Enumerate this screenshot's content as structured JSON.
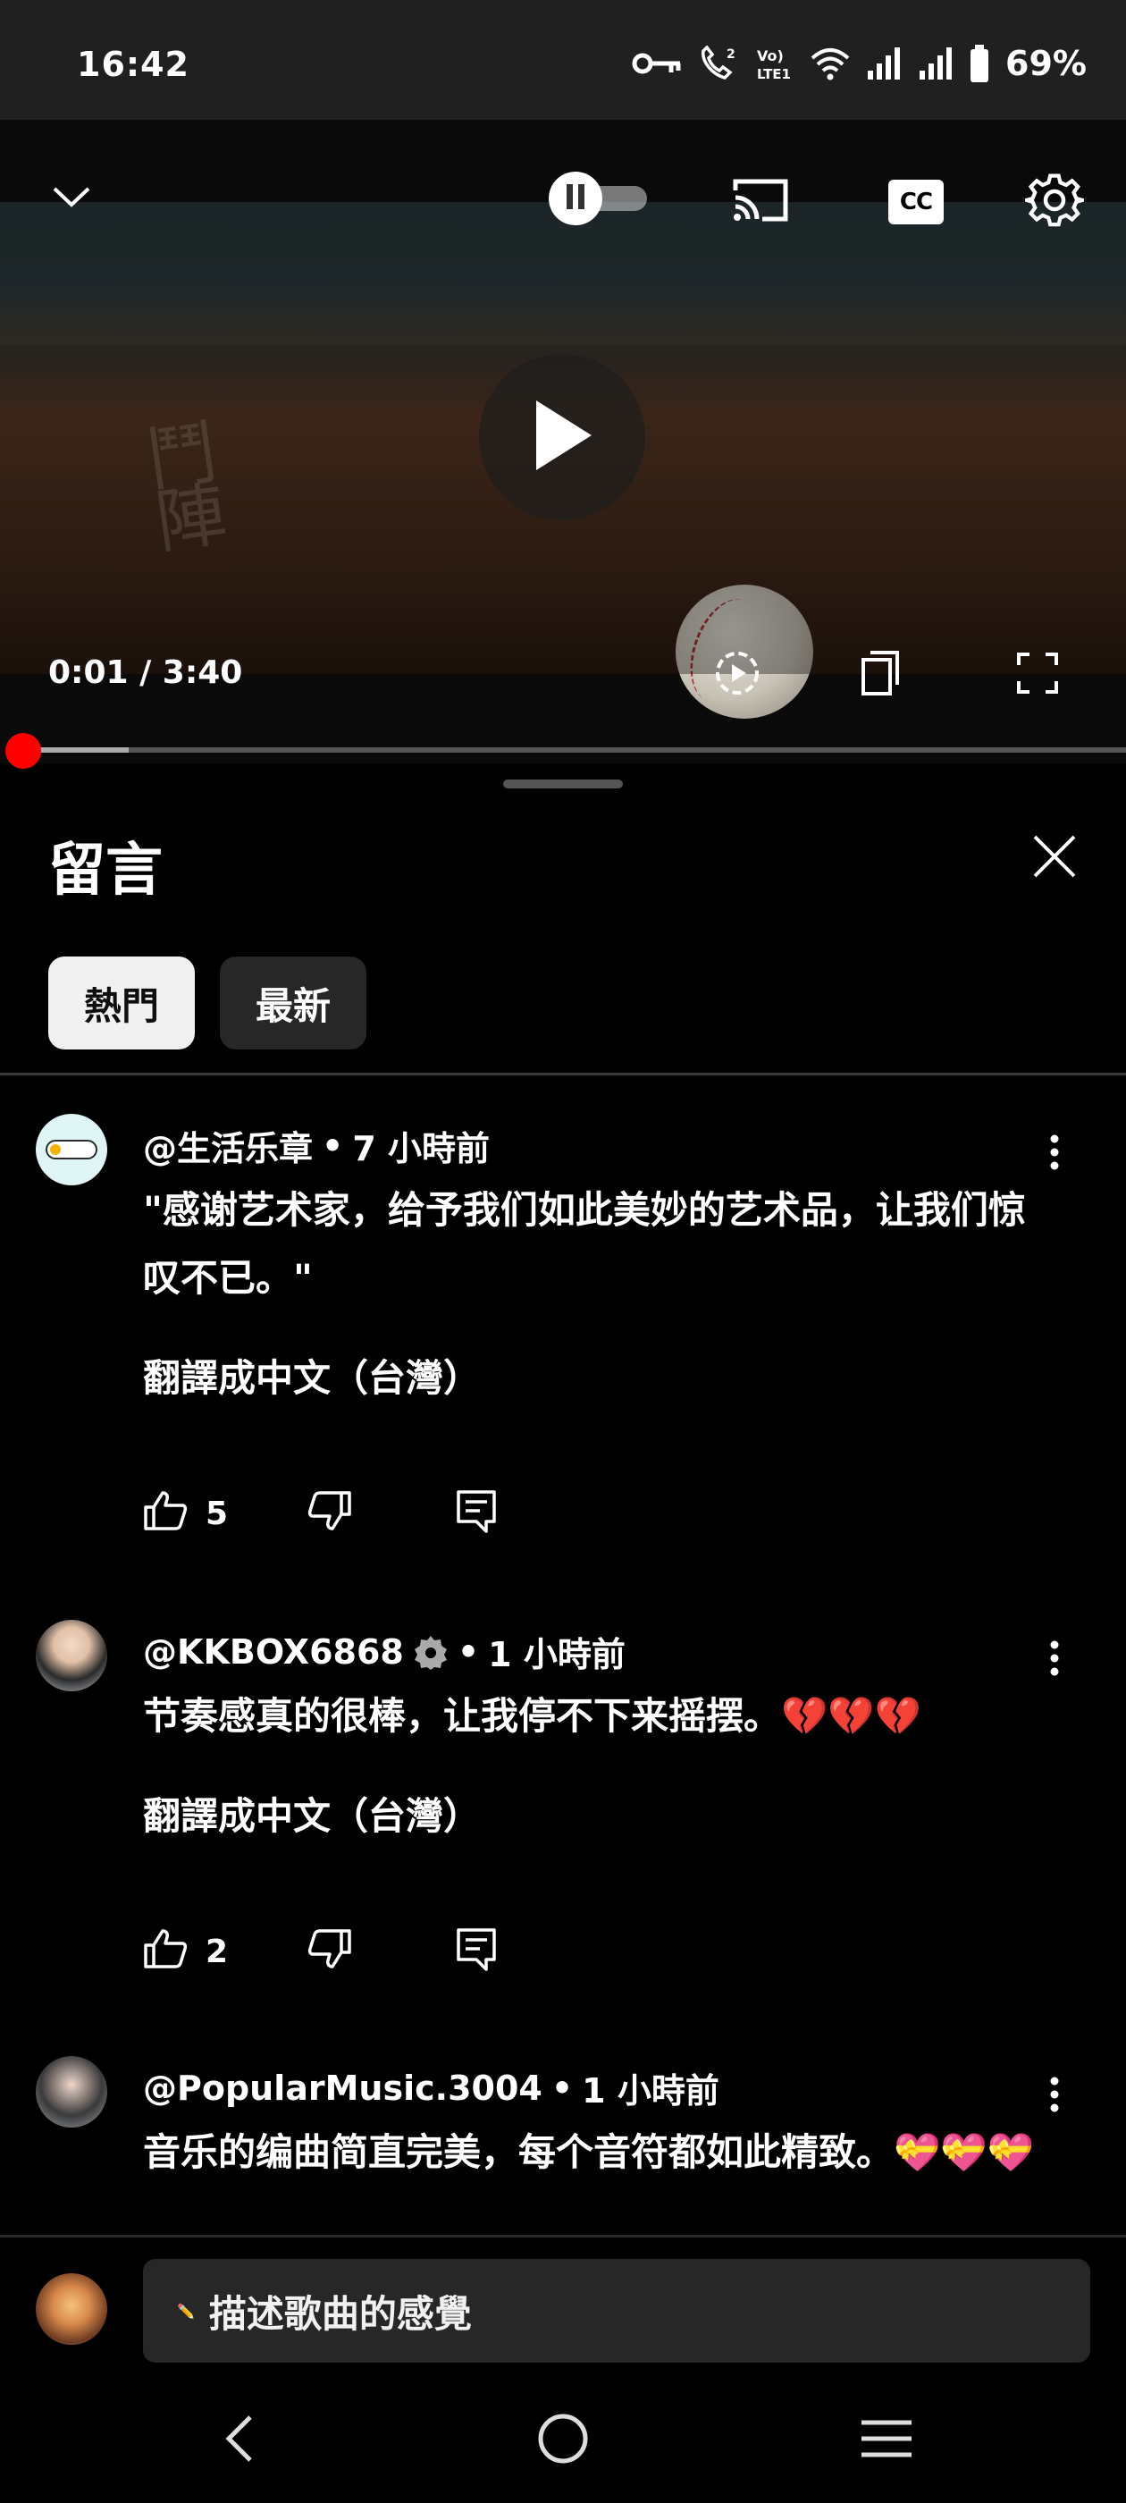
{
  "status_bar": {
    "time": "16:42",
    "battery": "69%",
    "icons": [
      "key-icon",
      "wifi-calling-icon",
      "volte-icon",
      "wifi-icon",
      "signal-icon",
      "signal-icon-2",
      "battery-icon"
    ]
  },
  "player": {
    "current_time": "0:01",
    "separator": "/",
    "duration": "3:40",
    "progress_fraction": 0.005,
    "buffer_fraction": 0.1,
    "cc_label": "CC",
    "autoplay_paused": true
  },
  "comments_panel": {
    "title": "留言",
    "chips": [
      "熱門",
      "最新"
    ],
    "active_chip": "熱門"
  },
  "comments": [
    {
      "author": "@生活乐章",
      "time": "7 小時前",
      "verified": false,
      "text": "\"感谢艺术家，给予我们如此美妙的艺术品，让我们惊叹不已。\"",
      "translate": "翻譯成中文（台灣）",
      "likes": "5"
    },
    {
      "author": "@KKBOX6868",
      "time": "1 小時前",
      "verified": true,
      "text": "节奏感真的很棒，让我停不下来摇摆。💔💔💔",
      "translate": "翻譯成中文（台灣）",
      "likes": "2"
    },
    {
      "author": "@PopularMusic.3004",
      "time": "1 小時前",
      "verified": false,
      "text": "音乐的编曲简直完美，每个音符都如此精致。💝💝💝"
    }
  ],
  "composer": {
    "placeholder_icon": "✏️",
    "placeholder": "描述歌曲的感覺"
  },
  "colors": {
    "accent": "#ff0000",
    "background": "#000000",
    "chip_active_bg": "#f1f1f1",
    "chip_inactive_bg": "#272727",
    "status_bar_bg": "#202020"
  }
}
